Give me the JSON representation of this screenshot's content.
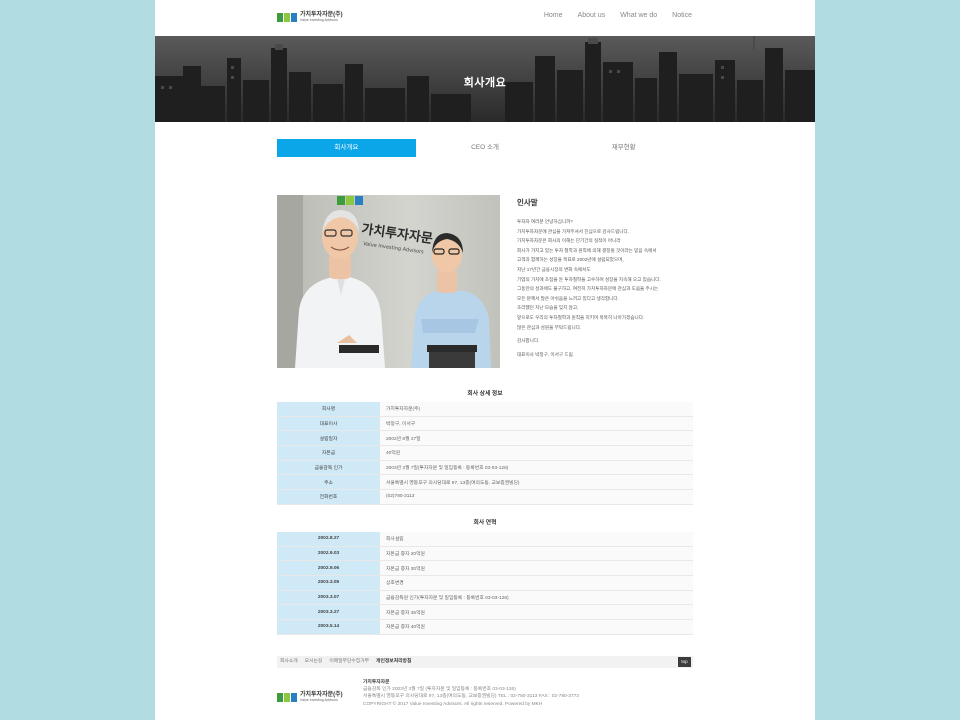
{
  "brand": {
    "name": "가치투자자문(주)",
    "sub": "Value Investing Advisors",
    "colors": [
      "#3d9a3d",
      "#8dc63f",
      "#2a7fc0",
      "#0aa6e8"
    ]
  },
  "nav": [
    "Home",
    "About us",
    "What we do",
    "Notice"
  ],
  "hero": {
    "title": "회사개요"
  },
  "tabs": [
    "회사개요",
    "CEO 소개",
    "재무현황"
  ],
  "photo": {
    "sign_text": "가치투자자문",
    "sign_sub": "Value Investing Advisors"
  },
  "greeting": {
    "heading": "인사말",
    "lines": [
      "투자자 여러분 안녕하십니까?",
      "가치투자자문에 관심을 가져주셔서 진심으로 감사드립니다.",
      "가치투자자문은 회사의 이해는 단기간의 실적이 아니라",
      "회사가 가지고 있는 투자 철학과 원칙에 의해 결정될 것이라는 믿음 속에서",
      "고객과 함께하는 성장을 목표로 2002년에 설립되었으며,",
      "지난 17년간 금융시장의 변화 속에서도",
      "기업의 가치에 초점을 둔 투자철학을 고수하며 성장을 지속해 오고 있습니다.",
      "그동안의 성과에도 불구하고, 여전히 가치투자자문에 관심과 도움을 주시는",
      "모든 분께서 많은 아쉬움을 느끼고 있다고 생각합니다.",
      "초라했던 지난 모습을 잊지 않고,",
      "앞으로도 우리의 투자철학과 원칙을 지키며 묵묵히 나아가겠습니다.",
      "많은 관심과 성원을 부탁드립니다."
    ],
    "thanks": "감사합니다.",
    "signature": "대표이사 박정구, 이서구 드림"
  },
  "details": {
    "title": "회사 상세 정보",
    "rows": [
      {
        "k": "회사명",
        "v": "가치투자자문(주)"
      },
      {
        "k": "대표이사",
        "v": "박정구, 이서구"
      },
      {
        "k": "설립일자",
        "v": "2002년 8월 27일"
      },
      {
        "k": "자본금",
        "v": "40억원"
      },
      {
        "k": "금융감독 인가",
        "v": "2003년 3월 7일(투자자문 및 일임등록 : 등록번호 03-03-126)"
      },
      {
        "k": "주소",
        "v": "서울특별시 영등포구 의사당대로 97, 13층(여의도동, 교보증권빌딩)"
      },
      {
        "k": "전화번호",
        "v": "(02)780-3113"
      }
    ]
  },
  "history": {
    "title": "회사 연혁",
    "rows": [
      {
        "k": "2002.8.27",
        "v": "회사설립"
      },
      {
        "k": "2002.9.03",
        "v": "자본금 증자 20억원"
      },
      {
        "k": "2002.9.06",
        "v": "자본금 증자 30억원"
      },
      {
        "k": "2003.3.05",
        "v": "상호변경"
      },
      {
        "k": "2003.3.07",
        "v": "금융감독원 인가(투자자문 및 일임등록 : 등록번호 03-03-126)"
      },
      {
        "k": "2003.3.27",
        "v": "자본금 증자 35억원"
      },
      {
        "k": "2003.5.14",
        "v": "자본금 증자 40억원"
      }
    ]
  },
  "footer": {
    "links": [
      "회사소개",
      "오시는길",
      "이메일무단수집거부",
      "개인정보처리방침"
    ],
    "top": "top",
    "company": "가치투자자문",
    "info1": "금융감독 인가 2003년 3월 7일 (투자자문 및 일임등록 : 등록번호 03-03-126)",
    "info2": "서울특별시 영등포구 의사당대로 97, 13층(여의도동, 교보증권빌딩) TEL : 02-780-3113 FAX : 02-780-3773",
    "copyright": "COPYRIGHT © 2017 Value Investing Advisors. All rights reserved. Powered by MKH"
  }
}
